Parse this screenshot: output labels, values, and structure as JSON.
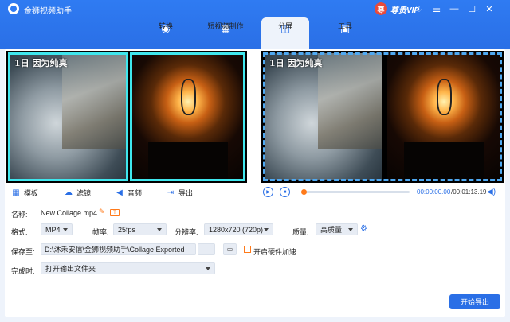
{
  "app": {
    "title": "金狮视频助手",
    "vip_label": "尊贵VIP",
    "vip_badge": "尊"
  },
  "window_controls": [
    "♡",
    "☰",
    "—",
    "☐",
    "✕"
  ],
  "nav": {
    "tabs": [
      {
        "label": "转换",
        "icon": "convert-icon",
        "glyph": "◉"
      },
      {
        "label": "短视频制作",
        "icon": "image-icon",
        "glyph": "▦"
      },
      {
        "label": "分屏",
        "icon": "split-screen-icon",
        "glyph": "◫"
      },
      {
        "label": "工具",
        "icon": "toolbox-icon",
        "glyph": "▣"
      }
    ],
    "active": "分屏"
  },
  "preview": {
    "caption_left": "1日 因为纯真",
    "caption_right": "1日 因为纯真"
  },
  "tools": {
    "template": "模板",
    "filter": "滤镜",
    "audio": "音频",
    "export": "导出"
  },
  "player": {
    "current_time": "00:00:00.00",
    "total_time": "/00:01:13.19",
    "progress": 0
  },
  "form": {
    "name_label": "名称:",
    "name_value": "New Collage.mp4",
    "format_label": "格式:",
    "format_value": "MP4",
    "fps_label": "帧率:",
    "fps_value": "25fps",
    "resolution_label": "分辨率:",
    "resolution_value": "1280x720 (720p)",
    "quality_label": "质量:",
    "quality_value": "高质量",
    "save_label": "保存至:",
    "save_path": "D:\\沐禾安信\\金狮视频助手\\Collage Exported",
    "browse_label": "···",
    "hw_accel_label": "开启硬件加速",
    "on_complete_label": "完成时:",
    "on_complete_value": "打开输出文件夹"
  },
  "start_export_label": "开始导出",
  "colors": {
    "primary": "#2a6fe6",
    "accent": "#ff7a1a",
    "frame_active": "#3fe7ee"
  }
}
